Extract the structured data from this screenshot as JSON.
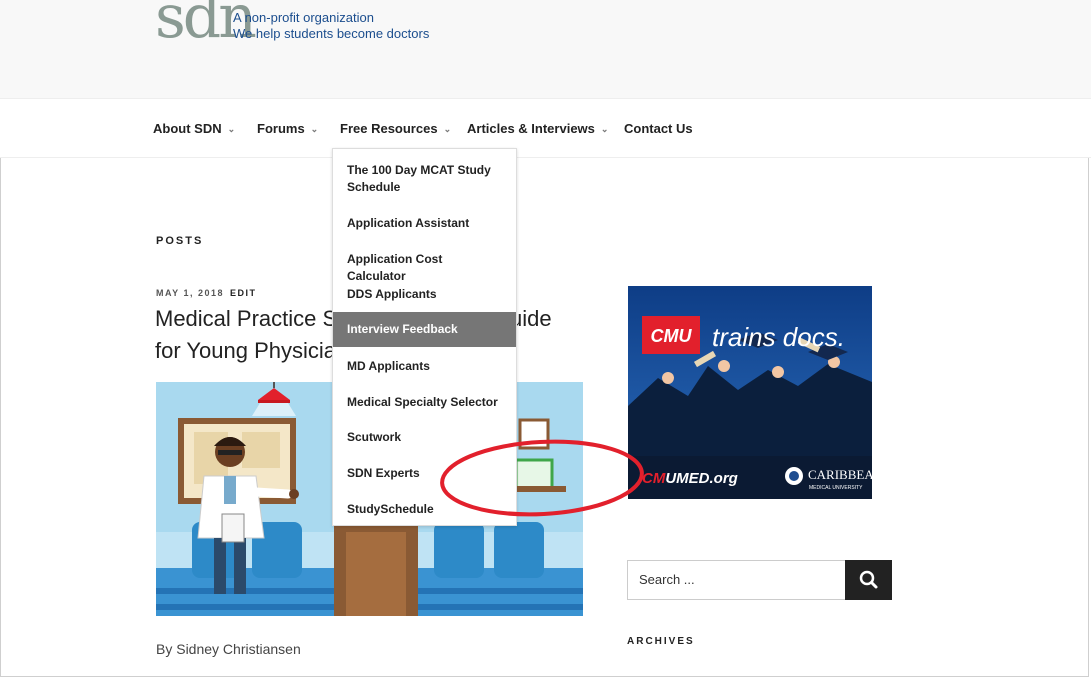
{
  "header": {
    "logo_text": "sdn",
    "tagline_1": "A non-profit organization",
    "tagline_2": "We help students become doctors"
  },
  "nav": {
    "items": [
      "About SDN",
      "Forums",
      "Free Resources",
      "Articles & Interviews",
      "Contact Us"
    ]
  },
  "dropdown": {
    "items": [
      "The 100 Day MCAT Study Schedule",
      "Application Assistant",
      "Application Cost Calculator",
      "DDS Applicants",
      "Interview Feedback",
      "MD Applicants",
      "Medical Specialty Selector",
      "Scutwork",
      "SDN Experts",
      "StudySchedule"
    ],
    "highlighted": "Interview Feedback"
  },
  "main": {
    "section_label": "POSTS",
    "post_date": "MAY 1, 2018",
    "post_edit": "EDIT",
    "post_title": "Medical Practice Startup Guide for Young Physicians",
    "post_title_visible_1": "Medical Practice S",
    "post_title_visible_1b": "uide",
    "post_title_visible_2": "for Young Physicia",
    "byline": "By Sidney Christiansen"
  },
  "sidebar": {
    "ad": {
      "badge": "CMU",
      "slogan": "trains docs.",
      "url_prefix": "CM",
      "url_suffix": "UMED.org",
      "brand": "CARIBBEAN",
      "brand_sub": "MEDICAL UNIVERSITY"
    },
    "search_placeholder": "Search ...",
    "archives_label": "ARCHIVES"
  },
  "colors": {
    "accent_red": "#e2202c",
    "nav_highlight": "#767676",
    "tagline_blue": "#1c4e8e"
  }
}
